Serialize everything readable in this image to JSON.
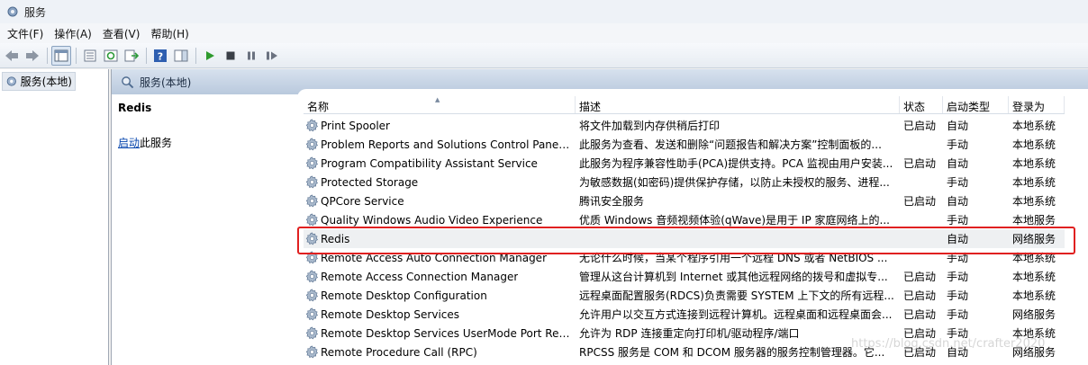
{
  "window": {
    "title": "服务",
    "icon": "services-gear-icon"
  },
  "menu": {
    "items": [
      "文件(F)",
      "操作(A)",
      "查看(V)",
      "帮助(H)"
    ]
  },
  "toolbar": {
    "icons": [
      "back-arrow-icon",
      "forward-arrow-icon",
      "show-tree-icon",
      "properties-icon",
      "refresh-icon",
      "export-list-icon",
      "help-icon",
      "show-pane-icon",
      "start-service-icon",
      "stop-service-icon",
      "pause-service-icon",
      "restart-service-icon"
    ]
  },
  "tree": {
    "node_label": "服务(本地)"
  },
  "pane": {
    "header": "服务(本地)"
  },
  "detail": {
    "service_name": "Redis",
    "action_link": "启动",
    "action_suffix": "此服务"
  },
  "columns": {
    "name": "名称",
    "desc": "描述",
    "status": "状态",
    "startup": "启动类型",
    "logon": "登录为"
  },
  "services": [
    {
      "name": "Print Spooler",
      "desc": "将文件加载到内存供稍后打印",
      "status": "已启动",
      "startup": "自动",
      "logon": "本地系统"
    },
    {
      "name": "Problem Reports and Solutions Control Panel ...",
      "desc": "此服务为查看、发送和删除“问题报告和解决方案”控制面板的...",
      "status": "",
      "startup": "手动",
      "logon": "本地系统"
    },
    {
      "name": "Program Compatibility Assistant Service",
      "desc": "此服务为程序兼容性助手(PCA)提供支持。PCA 监视由用户安装...",
      "status": "已启动",
      "startup": "自动",
      "logon": "本地系统"
    },
    {
      "name": "Protected Storage",
      "desc": "为敏感数据(如密码)提供保护存储，以防止未授权的服务、进程...",
      "status": "",
      "startup": "手动",
      "logon": "本地系统"
    },
    {
      "name": "QPCore Service",
      "desc": "腾讯安全服务",
      "status": "已启动",
      "startup": "自动",
      "logon": "本地系统"
    },
    {
      "name": "Quality Windows Audio Video Experience",
      "desc": "优质 Windows 音频视频体验(qWave)是用于 IP 家庭网络上的...",
      "status": "",
      "startup": "手动",
      "logon": "本地服务"
    },
    {
      "name": "Redis",
      "desc": "",
      "status": "",
      "startup": "自动",
      "logon": "网络服务"
    },
    {
      "name": "Remote Access Auto Connection Manager",
      "desc": "无论什么时候，当某个程序引用一个远程 DNS 或者 NetBIOS ...",
      "status": "",
      "startup": "手动",
      "logon": "本地系统"
    },
    {
      "name": "Remote Access Connection Manager",
      "desc": "管理从这台计算机到 Internet 或其他远程网络的拨号和虚拟专...",
      "status": "已启动",
      "startup": "手动",
      "logon": "本地系统"
    },
    {
      "name": "Remote Desktop Configuration",
      "desc": "远程桌面配置服务(RDCS)负责需要 SYSTEM 上下文的所有远程...",
      "status": "已启动",
      "startup": "手动",
      "logon": "本地系统"
    },
    {
      "name": "Remote Desktop Services",
      "desc": "允许用户以交互方式连接到远程计算机。远程桌面和远程桌面会...",
      "status": "已启动",
      "startup": "手动",
      "logon": "网络服务"
    },
    {
      "name": "Remote Desktop Services UserMode Port Red...",
      "desc": "允许为 RDP 连接重定向打印机/驱动程序/端口",
      "status": "已启动",
      "startup": "手动",
      "logon": "本地系统"
    },
    {
      "name": "Remote Procedure Call (RPC)",
      "desc": "RPCSS 服务是 COM 和 DCOM 服务器的服务控制管理器。它...",
      "status": "已启动",
      "startup": "自动",
      "logon": "网络服务"
    }
  ],
  "watermark": "https://blog.csdn.net/crafter2020",
  "colors": {
    "highlight_border": "#e02020",
    "link": "#0645ad",
    "header_bg": "#c7d5e6"
  }
}
